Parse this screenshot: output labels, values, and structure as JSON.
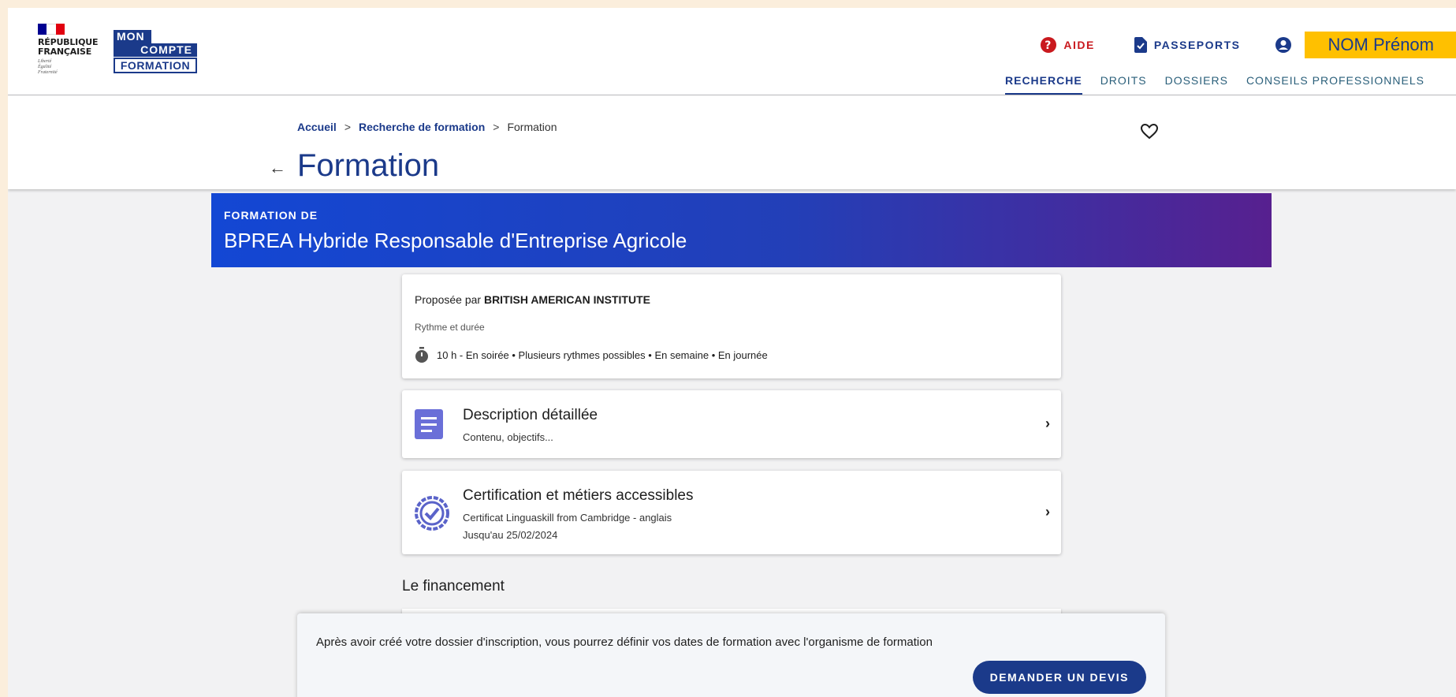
{
  "header": {
    "rf_logo": {
      "name_line1": "RÉPUBLIQUE",
      "name_line2": "FRANÇAISE",
      "motto1": "Liberté",
      "motto2": "Égalité",
      "motto3": "Fraternité"
    },
    "mcf_logo": {
      "line1": "MON",
      "line2": "COMPTE",
      "line3": "FORMATION"
    },
    "top_links": {
      "aide": "AIDE",
      "passeports": "PASSEPORTS"
    },
    "user_name": "NOM Prénom",
    "nav": [
      "RECHERCHE",
      "DROITS",
      "DOSSIERS",
      "CONSEILS PROFESSIONNELS"
    ],
    "nav_active": "RECHERCHE"
  },
  "breadcrumb": {
    "home": "Accueil",
    "search": "Recherche de formation",
    "current": "Formation",
    "sep": ">"
  },
  "page_title": "Formation",
  "back_arrow": "←",
  "banner": {
    "kicker": "FORMATION DE",
    "title": "BPREA Hybride Responsable d'Entreprise Agricole"
  },
  "info_card": {
    "provider_prefix": "Proposée par ",
    "provider_name": "BRITISH AMERICAN INSTITUTE",
    "rythme_label": "Rythme et durée",
    "rythme": "10 h -  En soirée • Plusieurs rythmes possibles • En semaine • En journée"
  },
  "desc_card": {
    "title": "Description détaillée",
    "subtitle": "Contenu, objectifs..."
  },
  "cert_card": {
    "title": "Certification et métiers accessibles",
    "subtitle": "Certificat Linguaskill from Cambridge - anglais",
    "until": "Jusqu'au 25/02/2024"
  },
  "chevron": "›",
  "financement_title": "Le financement",
  "footer": {
    "text": "Après avoir créé votre dossier d'inscription, vous pourrez définir vos dates de formation avec l'organisme de formation",
    "button": "DEMANDER UN DEVIS"
  },
  "colors": {
    "primary": "#1b3a8a",
    "aide": "#c9191e",
    "highlight": "#ffc000",
    "page_bg": "#f2f2f3",
    "outer_bg": "#fbeedc"
  },
  "icons": [
    "question-circle-icon",
    "passport-doc-icon",
    "user-circle-icon",
    "heart-outline-icon",
    "stopwatch-icon",
    "document-list-icon",
    "certificate-badge-icon",
    "chevron-right-icon",
    "arrow-left-icon"
  ]
}
